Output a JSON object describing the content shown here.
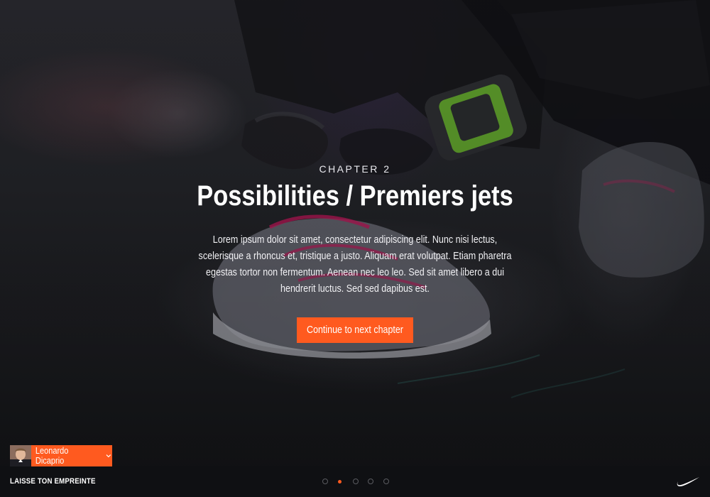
{
  "chapter": {
    "label": "CHAPTER 2",
    "title": "Possibilities / Premiers jets",
    "body": "Lorem ipsum dolor sit amet, consectetur adipiscing elit. Nunc nisi lectus, scelerisque a rhoncus et, tristique a justo. Aliquam erat volutpat. Etiam pharetra egestas tortor non fermentum. Aenean nec leo leo. Sed sit amet libero a dui hendrerit luctus. Sed sed dapibus est.",
    "cta_label": "Continue to next chapter"
  },
  "user": {
    "name": "Leonardo Dicaprio",
    "avatar_icon": "avatar-icon",
    "menu_icon": "chevron-down-icon"
  },
  "footer": {
    "brand_text": "LAISSE TON EMPREINTE",
    "pager": {
      "count": 5,
      "active_index": 1
    },
    "logo_icon": "nike-swoosh-icon"
  },
  "colors": {
    "accent": "#ff5a1f",
    "bar_background": "#0f1013",
    "text": "#ffffff"
  }
}
